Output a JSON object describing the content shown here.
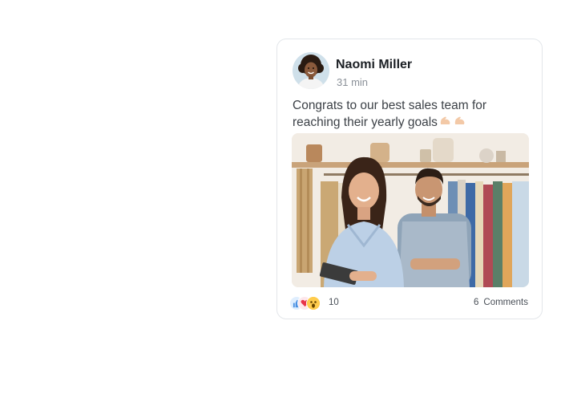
{
  "post": {
    "author": "Naomi Miller",
    "time": "31 min",
    "text": "Congrats to our best sales team for reaching their yearly goals",
    "text_emoji": [
      "flexed-biceps",
      "flexed-biceps"
    ],
    "image_alt": "Two smiling shop owners standing in a clothing store",
    "reactions": {
      "icons": [
        "like-icon",
        "heart-icon",
        "wow-icon"
      ],
      "count": "10"
    },
    "comments": {
      "count": "6",
      "label": "Comments"
    }
  },
  "colors": {
    "card_border": "#e3e6ea",
    "author": "#1b1f24",
    "muted": "#8a9098",
    "like": "#4a90e2",
    "heart": "#e8334a",
    "wow": "#ffcc4d"
  }
}
